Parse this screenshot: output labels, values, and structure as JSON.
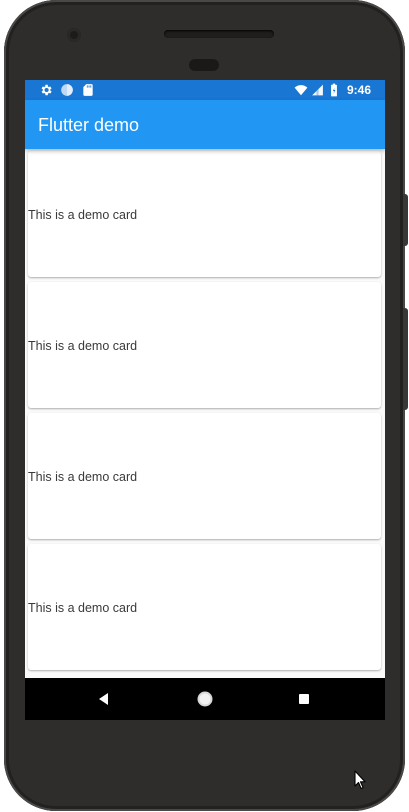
{
  "status_bar": {
    "time": "9:46",
    "left_icons": [
      "settings-icon",
      "sync-icon",
      "sd-card-icon"
    ],
    "right_icons": [
      "wifi-icon",
      "cell-signal-icon",
      "battery-icon"
    ],
    "color": "#1976d2"
  },
  "app_bar": {
    "title": "Flutter demo",
    "color": "#2196f3"
  },
  "cards": [
    {
      "text": "This is a demo card"
    },
    {
      "text": "This is a demo card"
    },
    {
      "text": "This is a demo card"
    },
    {
      "text": "This is a demo card"
    }
  ],
  "nav_bar": {
    "buttons": [
      "back-icon",
      "home-icon",
      "recents-icon"
    ]
  }
}
